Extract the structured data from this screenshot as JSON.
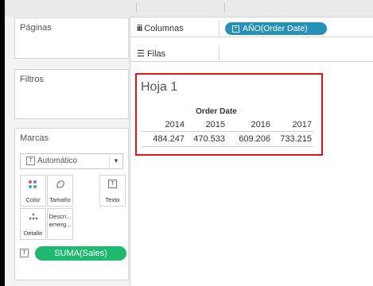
{
  "cards": {
    "pages_title": "Páginas",
    "filters_title": "Filtros",
    "marks_title": "Marcas",
    "mark_type": "Automático",
    "buttons": {
      "color": "Color",
      "size": "Tamaño",
      "text": "Texto",
      "detail": "Detalle",
      "tooltip_line1": "Descri...",
      "tooltip_line2": "emerg..."
    },
    "text_icon": "T",
    "measure_pill": "SUMA(Sales)"
  },
  "shelves": {
    "columns_label": "Columnas",
    "columns_pill": "AÑO(Order Date)",
    "rows_label": "Filas"
  },
  "view": {
    "title": "Hoja 1",
    "column_header": "Order Date",
    "years": [
      "2014",
      "2015",
      "2016",
      "2017"
    ],
    "values": [
      "484.247",
      "470.533",
      "609.206",
      "733.215"
    ]
  },
  "colors": {
    "measure_pill": "#1eb96e",
    "dimension_pill": "#2891b8",
    "highlight_border": "#e01818"
  }
}
